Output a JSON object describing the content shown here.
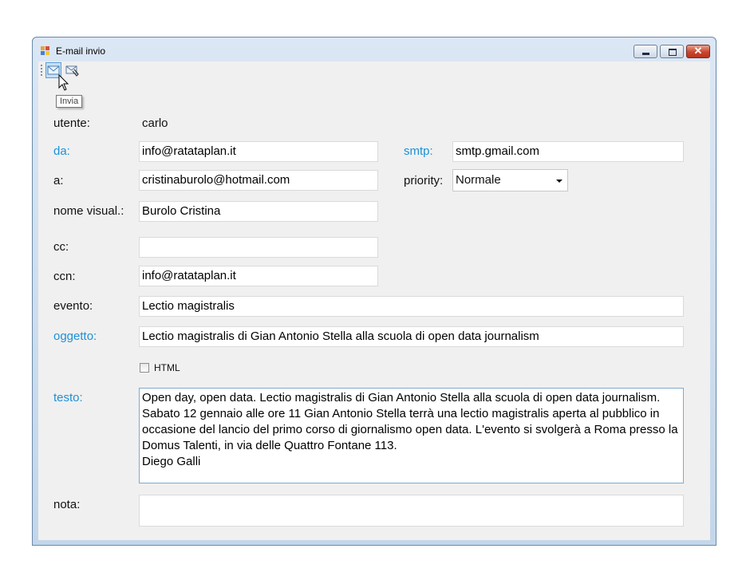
{
  "window": {
    "title": "E-mail invio"
  },
  "toolbar": {
    "send_icon": "envelope-icon",
    "attach_icon": "envelope-attachment-icon",
    "tooltip": "Invia"
  },
  "form": {
    "utente_label": "utente:",
    "utente_value": "carlo",
    "da_label": "da:",
    "da_value": "info@ratataplan.it",
    "smtp_label": "smtp:",
    "smtp_value": "smtp.gmail.com",
    "a_label": "a:",
    "a_value": "cristinaburolo@hotmail.com",
    "priority_label": "priority:",
    "priority_value": "Normale",
    "nome_label": "nome visual.:",
    "nome_value": "Burolo Cristina",
    "cc_label": "cc:",
    "cc_value": "",
    "ccn_label": "ccn:",
    "ccn_value": "info@ratataplan.it",
    "evento_label": "evento:",
    "evento_value": "Lectio magistralis",
    "oggetto_label": "oggetto:",
    "oggetto_value": "Lectio magistralis di Gian Antonio Stella alla scuola di open data journalism",
    "html_label": "HTML",
    "html_checked": false,
    "testo_label": "testo:",
    "testo_value": "Open day, open data. Lectio magistralis di Gian Antonio Stella alla scuola di open data journalism. Sabato 12 gennaio alle ore 11 Gian Antonio Stella terrà una lectio magistralis aperta al pubblico in occasione del lancio del primo corso di giornalismo open data. L'evento si svolgerà a Roma presso la Domus Talenti, in via delle Quattro Fontane 113.\nDiego Galli",
    "nota_label": "nota:",
    "nota_value": ""
  },
  "colors": {
    "required_label": "#1e90d6",
    "close_button": "#c9452c"
  }
}
